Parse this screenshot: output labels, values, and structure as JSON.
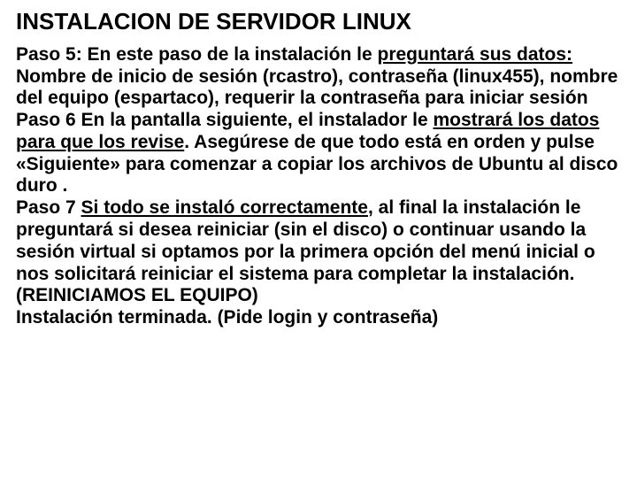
{
  "title": "INSTALACION DE SERVIDOR LINUX",
  "p5_lead": "Paso 5: En este paso de la instalación le ",
  "p5_u": "preguntará sus datos:",
  "p5_rest": "Nombre de inicio de sesión (rcastro),  contraseña (linux455), nombre del equipo (espartaco), requerir la contraseña para iniciar sesión",
  "p6_a": "Paso 6 En la pantalla siguiente,  el instalador le ",
  "p6_u1": "mostrará los datos para que los revise",
  "p6_b": ". Asegúrese de que todo está en orden y pulse «Siguiente» para comenzar a copiar los archivos de Ubuntu al disco duro .",
  "p7_a": "Paso 7 ",
  "p7_u1": "Si todo se instaló correctamente",
  "p7_b": ", al final la instalación le preguntará si desea reiniciar (sin el disco) o continuar usando la sesión virtual si optamos por la primera opción del menú inicial o nos solicitará reiniciar el sistema para completar la instalación. (REINICIAMOS EL EQUIPO)",
  "p_end": "Instalación terminada. (Pide login y contraseña)"
}
